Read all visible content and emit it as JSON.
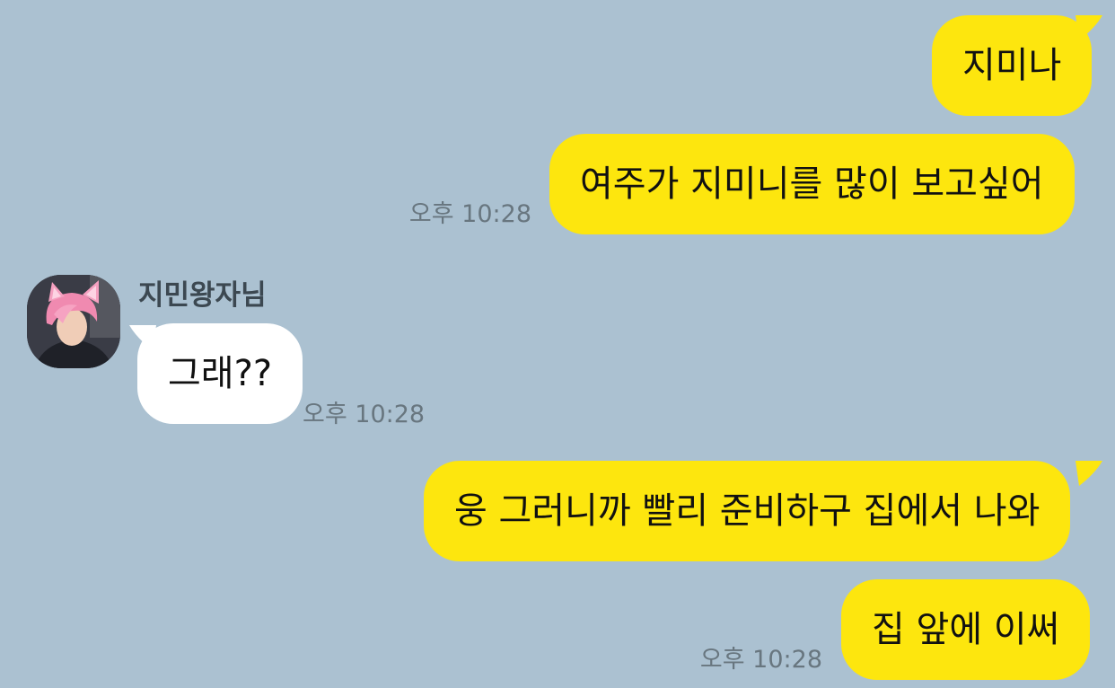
{
  "messages": [
    {
      "text": "지미나"
    },
    {
      "text": "여주가 지미니를 많이 보고싶어",
      "time": "오후 10:28"
    },
    {
      "text": "그래??",
      "time": "오후 10:28"
    },
    {
      "text": "웅 그러니까 빨리 준비하구 집에서 나와"
    },
    {
      "text": "집 앞에 이써",
      "time": "오후 10:28"
    }
  ],
  "contact": {
    "name": "지민왕자님"
  },
  "colors": {
    "background": "#abc1d1",
    "my_bubble": "#fde60e",
    "their_bubble": "#ffffff",
    "timestamp": "#68767f"
  }
}
